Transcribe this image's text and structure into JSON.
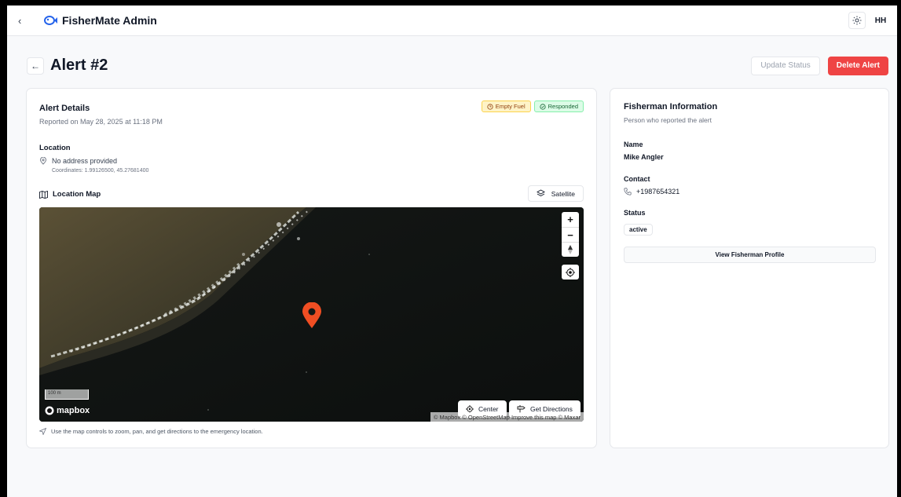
{
  "app": {
    "title": "FisherMate Admin",
    "user_initials": "HH",
    "accent_color": "#2563eb"
  },
  "page": {
    "title": "Alert #2",
    "update_status_label": "Update Status",
    "delete_alert_label": "Delete Alert"
  },
  "alert_details": {
    "title": "Alert Details",
    "reported_on": "Reported on May 28, 2025 at 11:18 PM",
    "badges": {
      "type": "Empty Fuel",
      "status": "Responded"
    },
    "location_label": "Location",
    "address": "No address provided",
    "coordinates": "Coordinates: 1.99126500, 45.27681400",
    "map_label": "Location Map",
    "satellite_label": "Satellite",
    "map": {
      "scale_label": "100 m",
      "logo_text": "mapbox",
      "attribution": "© Mapbox © OpenStreetMap Improve this map © Maxar",
      "center_label": "Center",
      "directions_label": "Get Directions"
    },
    "hint": "Use the map controls to zoom, pan, and get directions to the emergency location."
  },
  "fisherman": {
    "title": "Fisherman Information",
    "subtitle": "Person who reported the alert",
    "name_label": "Name",
    "name": "Mike Angler",
    "contact_label": "Contact",
    "contact": "+1987654321",
    "status_label": "Status",
    "status": "active",
    "profile_button": "View Fisherman Profile"
  }
}
